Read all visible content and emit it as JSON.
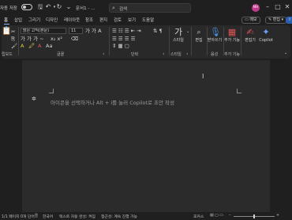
{
  "titlebar": {
    "autosave_label": "자동 저장",
    "doc_name": "문서1 - …",
    "search_placeholder": "검색",
    "avatar_initials": "NH"
  },
  "tabs": [
    {
      "label": "홈",
      "active": true
    },
    {
      "label": "삽입"
    },
    {
      "label": "그리기"
    },
    {
      "label": "디자인"
    },
    {
      "label": "레이아웃"
    },
    {
      "label": "참조"
    },
    {
      "label": "편지"
    },
    {
      "label": "검토"
    },
    {
      "label": "보기"
    },
    {
      "label": "도움말"
    }
  ],
  "tab_actions": {
    "memo": "메모",
    "edit": "편집",
    "share": "공유"
  },
  "ribbon": {
    "font_name": "맑은 고딕(본문)",
    "font_size": "11",
    "font_glyphs": "가 가 A",
    "bold_row": "가 가 가 ~",
    "para_glyphs": "☰ ☰ ☰ ☰",
    "clipboard_label": "립보드",
    "font_label": "글꼴",
    "paragraph_label": "단락",
    "styles_label": "스타일",
    "styles_btn": "스타일",
    "editing_btn": "편집",
    "dictate_btn": "받아쓰기",
    "voice_label": "음성",
    "addin_btn": "추가 기능",
    "addin_label": "추가 기능",
    "editor_btn": "편집기",
    "copilot_btn": "Copilot"
  },
  "document": {
    "placeholder": "아이콘을 선택하거나 Alt + i를 눌러 Copilot로 초안 작성"
  },
  "statusbar": {
    "page": "1/1 페이지",
    "words": "0개 단어",
    "lang": "한국어",
    "predict": "텍스트 자동 완성: 켜짐",
    "accessibility": "접근성: 계속 진행 가능",
    "focus": "포커스"
  },
  "colors": {
    "accent": "#8ab4f8",
    "avatar": "#c03a8c",
    "background": "#1f1f1f",
    "page": "#2b2b2b"
  }
}
